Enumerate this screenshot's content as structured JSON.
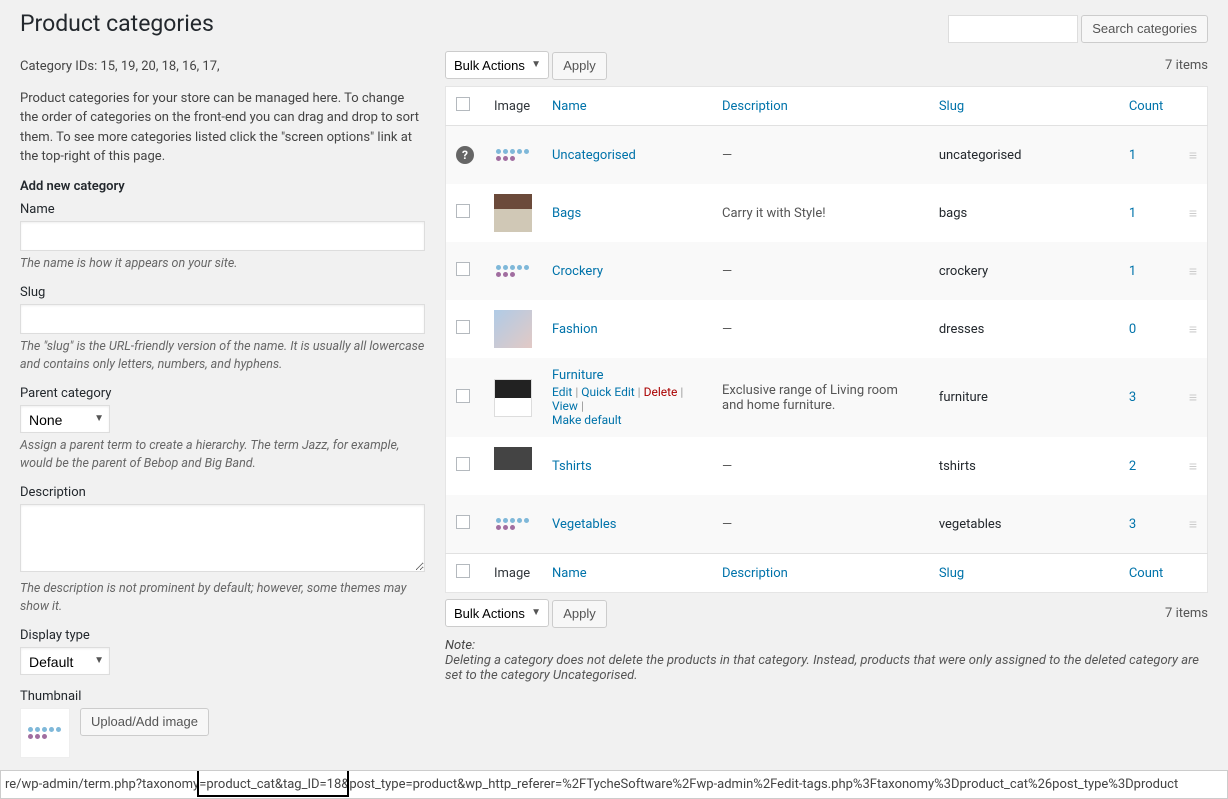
{
  "page": {
    "title": "Product categories",
    "category_ids_line": "Category IDs: 15, 19, 20, 18, 16, 17,",
    "intro": "Product categories for your store can be managed here. To change the order of categories on the front-end you can drag and drop to sort them. To see more categories listed click the \"screen options\" link at the top-right of this page."
  },
  "search": {
    "button": "Search categories"
  },
  "form": {
    "heading": "Add new category",
    "name_label": "Name",
    "name_hint": "The name is how it appears on your site.",
    "slug_label": "Slug",
    "slug_hint": "The \"slug\" is the URL-friendly version of the name. It is usually all lowercase and contains only letters, numbers, and hyphens.",
    "parent_label": "Parent category",
    "parent_selected": "None",
    "parent_hint": "Assign a parent term to create a hierarchy. The term Jazz, for example, would be the parent of Bebop and Big Band.",
    "description_label": "Description",
    "description_hint": "The description is not prominent by default; however, some themes may show it.",
    "display_label": "Display type",
    "display_selected": "Default",
    "thumbnail_label": "Thumbnail",
    "upload_button": "Upload/Add image"
  },
  "bulk": {
    "label": "Bulk Actions",
    "apply": "Apply"
  },
  "items_count": "7 items",
  "columns": {
    "image": "Image",
    "name": "Name",
    "description": "Description",
    "slug": "Slug",
    "count": "Count"
  },
  "row_actions": {
    "edit": "Edit",
    "quick_edit": "Quick Edit",
    "delete": "Delete",
    "view": "View",
    "make_default": "Make default"
  },
  "rows": [
    {
      "name": "Uncategorised",
      "description": "—",
      "slug": "uncategorised",
      "count": "1",
      "help": true,
      "thumb": "placeholder"
    },
    {
      "name": "Bags",
      "description": "Carry it with Style!",
      "slug": "bags",
      "count": "1",
      "thumb": "bags"
    },
    {
      "name": "Crockery",
      "description": "—",
      "slug": "crockery",
      "count": "1",
      "thumb": "placeholder"
    },
    {
      "name": "Fashion",
      "description": "—",
      "slug": "dresses",
      "count": "0",
      "thumb": "fashion"
    },
    {
      "name": "Furniture",
      "description": "Exclusive range of Living room and home furniture.",
      "slug": "furniture",
      "count": "3",
      "thumb": "furniture",
      "show_actions": true
    },
    {
      "name": "Tshirts",
      "description": "—",
      "slug": "tshirts",
      "count": "2",
      "thumb": "tshirts"
    },
    {
      "name": "Vegetables",
      "description": "—",
      "slug": "vegetables",
      "count": "3",
      "thumb": "placeholder"
    }
  ],
  "note": {
    "title": "Note:",
    "body": "Deleting a category does not delete the products in that category. Instead, products that were only assigned to the deleted category are set to the category Uncategorised."
  },
  "url_bar": {
    "prefix": "re/wp-admin/term.php?taxonomy",
    "highlight": "=product_cat&tag_ID=18&",
    "suffix": "post_type=product&wp_http_referer=%2FTycheSoftware%2Fwp-admin%2Fedit-tags.php%3Ftaxonomy%3Dproduct_cat%26post_type%3Dproduct"
  }
}
